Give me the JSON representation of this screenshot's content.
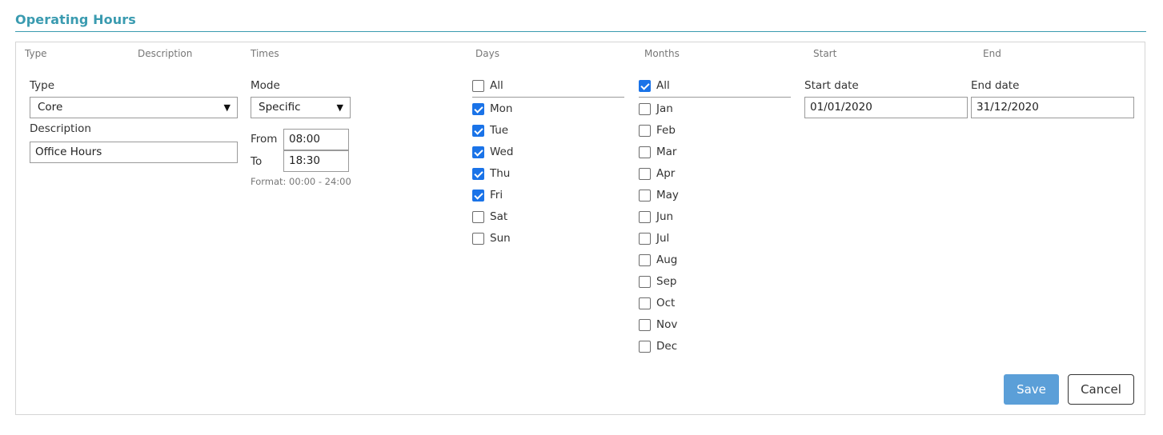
{
  "section": {
    "title": "Operating Hours"
  },
  "columns": [
    "Type",
    "Description",
    "Times",
    "Days",
    "Months",
    "Start",
    "End"
  ],
  "type_field": {
    "label": "Type",
    "value": "Core"
  },
  "description_field": {
    "label": "Description",
    "value": "Office Hours"
  },
  "mode_field": {
    "label": "Mode",
    "value": "Specific"
  },
  "times": {
    "from_label": "From",
    "from_value": "08:00",
    "to_label": "To",
    "to_value": "18:30",
    "format_hint": "Format: 00:00 - 24:00"
  },
  "days": {
    "all": {
      "label": "All",
      "checked": false
    },
    "items": [
      {
        "label": "Mon",
        "checked": true
      },
      {
        "label": "Tue",
        "checked": true
      },
      {
        "label": "Wed",
        "checked": true
      },
      {
        "label": "Thu",
        "checked": true
      },
      {
        "label": "Fri",
        "checked": true
      },
      {
        "label": "Sat",
        "checked": false
      },
      {
        "label": "Sun",
        "checked": false
      }
    ]
  },
  "months": {
    "all": {
      "label": "All",
      "checked": true
    },
    "items": [
      {
        "label": "Jan",
        "checked": false
      },
      {
        "label": "Feb",
        "checked": false
      },
      {
        "label": "Mar",
        "checked": false
      },
      {
        "label": "Apr",
        "checked": false
      },
      {
        "label": "May",
        "checked": false
      },
      {
        "label": "Jun",
        "checked": false
      },
      {
        "label": "Jul",
        "checked": false
      },
      {
        "label": "Aug",
        "checked": false
      },
      {
        "label": "Sep",
        "checked": false
      },
      {
        "label": "Oct",
        "checked": false
      },
      {
        "label": "Nov",
        "checked": false
      },
      {
        "label": "Dec",
        "checked": false
      }
    ]
  },
  "start_date": {
    "label": "Start date",
    "value": "01/01/2020"
  },
  "end_date": {
    "label": "End date",
    "value": "31/12/2020"
  },
  "buttons": {
    "save": "Save",
    "cancel": "Cancel"
  },
  "colors": {
    "accent": "#3a9bb0",
    "primary_button": "#5b9fd8",
    "checkbox_checked": "#1a73e8"
  }
}
